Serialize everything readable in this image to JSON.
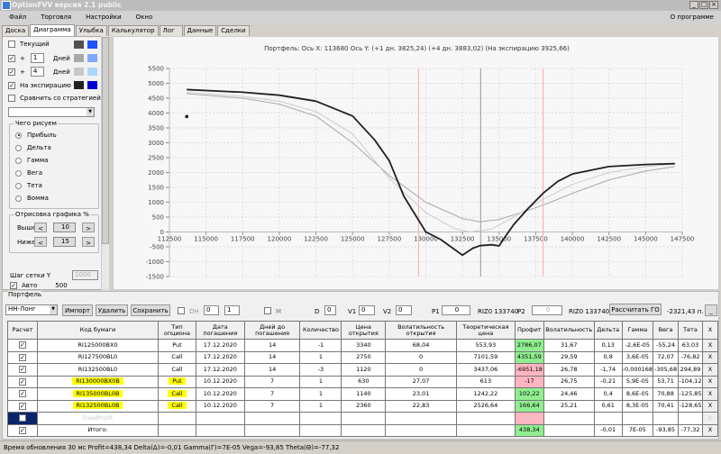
{
  "window": {
    "title": "OptionFVV версия 2.1 public",
    "minimize": "_",
    "maximize": "□",
    "close": "×"
  },
  "menu": [
    "Файл",
    "Торговля",
    "Настройки",
    "Окно"
  ],
  "about": "О программе",
  "tabs": [
    {
      "label": "Доска"
    },
    {
      "label": "Диаграмма",
      "active": true
    },
    {
      "label": "Улыбка"
    },
    {
      "label": "Калькулятор"
    },
    {
      "label": "Лог"
    },
    {
      "label": "Данные"
    },
    {
      "label": "Сделки"
    }
  ],
  "left": {
    "current": {
      "label": "Текущий",
      "checked": false,
      "colors": [
        "#505050",
        "#2050ff"
      ]
    },
    "plus1": {
      "plus": "+",
      "value": "1",
      "days": "Дней",
      "checked": true,
      "colors": [
        "#a8a8a8",
        "#80aaff"
      ]
    },
    "plus4": {
      "plus": "+",
      "value": "4",
      "days": "Дней",
      "checked": true,
      "colors": [
        "#c8c8c8",
        "#a8d8ff"
      ]
    },
    "expiry": {
      "label": "На экспирацию",
      "checked": true,
      "colors": [
        "#202020",
        "#0000d0"
      ]
    },
    "compare": {
      "label": "Сравнить со стратегией",
      "checked": false
    },
    "draw_group": "Чего рисуем",
    "radios": [
      "Прибыль",
      "Дельта",
      "Гамма",
      "Вега",
      "Тета",
      "Вомма"
    ],
    "radio_selected": 0,
    "pct_group": "Отрисовка графика %",
    "above": {
      "label": "Выше",
      "value": "10"
    },
    "below": {
      "label": "Ниже",
      "value": "15"
    },
    "prev": "<",
    "next": ">",
    "grid_step": {
      "label": "Шаг сетки Y",
      "value": "1000"
    },
    "auto": {
      "label": "Авто",
      "checked": true,
      "value": "500"
    }
  },
  "chart_data": {
    "type": "line",
    "title": "Портфель: Ось X: 113680 Ось Y:  (+1 дн. 3825,24)  (+4 дн. 3883,02)  (На экспирацию 3925,66)",
    "xlim": [
      112500,
      147500
    ],
    "ylim": [
      -1500,
      5500
    ],
    "xticks": [
      "112500",
      "115000",
      "117500",
      "120000",
      "122500",
      "125000",
      "127500",
      "130000",
      "132500",
      "135000",
      "137500",
      "140000",
      "142500",
      "145000",
      "147500"
    ],
    "yticks": [
      "5500",
      "5000",
      "4500",
      "4000",
      "3500",
      "3000",
      "2500",
      "2000",
      "1500",
      "1000",
      "500",
      "0",
      "-500",
      "-1000",
      "-1500"
    ],
    "grid": true,
    "vlines": [
      {
        "x": 129500,
        "color": "#ffaaaa"
      },
      {
        "x": 133740,
        "color": "#8899aa"
      },
      {
        "x": 138000,
        "color": "#ffaaaa"
      }
    ],
    "marker": {
      "x": 113680,
      "y": 3883
    },
    "series": [
      {
        "color": "#a8a8a8",
        "x": [
          113680,
          117500,
          120000,
          122500,
          125000,
          127500,
          130000,
          132500,
          133700,
          135000,
          136500,
          138000,
          140000,
          142500,
          145000,
          147000
        ],
        "y": [
          4650,
          4500,
          4300,
          3900,
          3000,
          1900,
          1000,
          450,
          340,
          420,
          650,
          900,
          1300,
          1750,
          2050,
          2200
        ]
      },
      {
        "color": "#cccccc",
        "x": [
          113680,
          117500,
          120000,
          122500,
          125000,
          127500,
          130000,
          132000,
          133000,
          134500,
          136000,
          138000,
          140000,
          142500,
          145000,
          147000
        ],
        "y": [
          4700,
          4560,
          4400,
          4050,
          3300,
          1800,
          650,
          100,
          0,
          100,
          500,
          1100,
          1600,
          2000,
          2200,
          2280
        ]
      },
      {
        "color": "#202020",
        "x": [
          113680,
          117500,
          120000,
          122500,
          125000,
          126500,
          127500,
          128500,
          130000,
          131000,
          132500,
          133200,
          133700,
          134500,
          135000,
          135500,
          136000,
          137000,
          138000,
          139000,
          140000,
          142500,
          145000,
          147000
        ],
        "y": [
          4790,
          4700,
          4600,
          4400,
          3900,
          3100,
          2400,
          1200,
          0,
          -250,
          -780,
          -550,
          -460,
          -430,
          -470,
          -100,
          250,
          800,
          1300,
          1700,
          1950,
          2200,
          2270,
          2300
        ]
      }
    ]
  },
  "portfolio": {
    "group": "Портфель",
    "name": "НН-Лонг",
    "import": "Импорт",
    "delete": "Удалить",
    "save": "Сохранить",
    "dh": "DH",
    "dh1": "0",
    "dh2": "1",
    "m": "M",
    "d": "D",
    "d_val": "0",
    "v1": "V1",
    "v1_val": "0",
    "v2": "V2",
    "v2_val": "0",
    "p1": "P1",
    "p1_val": "0",
    "p1_info": "RIZ0 133740",
    "p2": "P2",
    "p2_val": "0",
    "p2_info": "RIZ0 133740",
    "calc_go": "Рассчитать ГО",
    "go_value": "-2321,43 п.",
    "min": "_",
    "columns": [
      "Расчет",
      "Код бумаги",
      "Тип опциона",
      "Дата погашения",
      "Дней до погашения",
      "Количество",
      "Цена открытия",
      "Волатильность открытия",
      "Теоретическая цена",
      "Профит",
      "Волатильность",
      "Дельта",
      "Гамма",
      "Вега",
      "Тета",
      "X"
    ],
    "rows": [
      {
        "check": true,
        "code": "RI125000BX0",
        "type": "Put",
        "date": "17.12.2020",
        "days": "14",
        "qty": "-1",
        "price": "3340",
        "vol_open": "68,04",
        "theor": "553,93",
        "profit": "2786,07",
        "pc": "g",
        "vol": "31,67",
        "delta": "0,13",
        "gamma": "-2,6E-05",
        "vega": "-55,24",
        "theta": "63,03",
        "x": "X"
      },
      {
        "check": true,
        "code": "RI127500BL0",
        "type": "Call",
        "date": "17.12.2020",
        "days": "14",
        "qty": "1",
        "price": "2750",
        "vol_open": "0",
        "theor": "7101,59",
        "profit": "4351,59",
        "pc": "g",
        "vol": "29,59",
        "delta": "0,8",
        "gamma": "3,6E-05",
        "vega": "72,07",
        "theta": "-76,82",
        "x": "X"
      },
      {
        "check": true,
        "code": "RI132500BL0",
        "type": "Call",
        "date": "17.12.2020",
        "days": "14",
        "qty": "-3",
        "price": "1120",
        "vol_open": "0",
        "theor": "3437,06",
        "profit": "-6951,18",
        "pc": "r",
        "vol": "26,78",
        "delta": "-1,74",
        "gamma": "-0,000168",
        "vega": "-305,68",
        "theta": "294,89",
        "x": "X"
      },
      {
        "check": true,
        "code": "RI130000BX0B",
        "type": "Put",
        "hl": true,
        "date": "10.12.2020",
        "days": "7",
        "qty": "1",
        "price": "630",
        "vol_open": "27,07",
        "theor": "613",
        "profit": "-17",
        "pc": "r",
        "vol": "26,75",
        "delta": "-0,21",
        "gamma": "5,9E-05",
        "vega": "53,71",
        "theta": "-104,12",
        "x": "X"
      },
      {
        "check": true,
        "code": "RI135000BL0B",
        "type": "Call",
        "hl": true,
        "date": "10.12.2020",
        "days": "7",
        "qty": "1",
        "price": "1140",
        "vol_open": "23,01",
        "theor": "1242,22",
        "profit": "102,22",
        "pc": "g",
        "vol": "24,46",
        "delta": "0,4",
        "gamma": "8,6E-05",
        "vega": "70,88",
        "theta": "-125,85",
        "x": "X"
      },
      {
        "check": true,
        "code": "RI132500BL0B",
        "type": "Call",
        "hl": true,
        "date": "10.12.2020",
        "days": "7",
        "qty": "1",
        "price": "2360",
        "vol_open": "22,83",
        "theor": "2526,64",
        "profit": "166,64",
        "pc": "g",
        "vol": "25,21",
        "delta": "0,61",
        "gamma": "8,3E-05",
        "vega": "70,41",
        "theta": "-128,65",
        "x": "X"
      },
      {
        "check": false,
        "fixed": true,
        "code": "FixedProfit",
        "type": "",
        "date": "",
        "days": "",
        "qty": "",
        "price": "",
        "vol_open": "",
        "theor": "",
        "profit": "0/0",
        "pc": "r",
        "vol": "",
        "delta": "",
        "gamma": "",
        "vega": "",
        "theta": "",
        "x": "X"
      },
      {
        "check": true,
        "code": "Итого:",
        "type": "",
        "date": "",
        "days": "",
        "qty": "",
        "price": "",
        "vol_open": "",
        "theor": "",
        "profit": "438,34",
        "pc": "g",
        "vol": "",
        "delta": "-0,01",
        "gamma": "7E-05",
        "vega": "-93,85",
        "theta": "-77,32",
        "x": "X"
      }
    ]
  },
  "status": "Время обновления 30 мс  Profit=438,34 Delta(Δ)=-0,01 Gamma(Γ)=7E-05 Vega=-93,85 Theta(Θ)=-77,32"
}
